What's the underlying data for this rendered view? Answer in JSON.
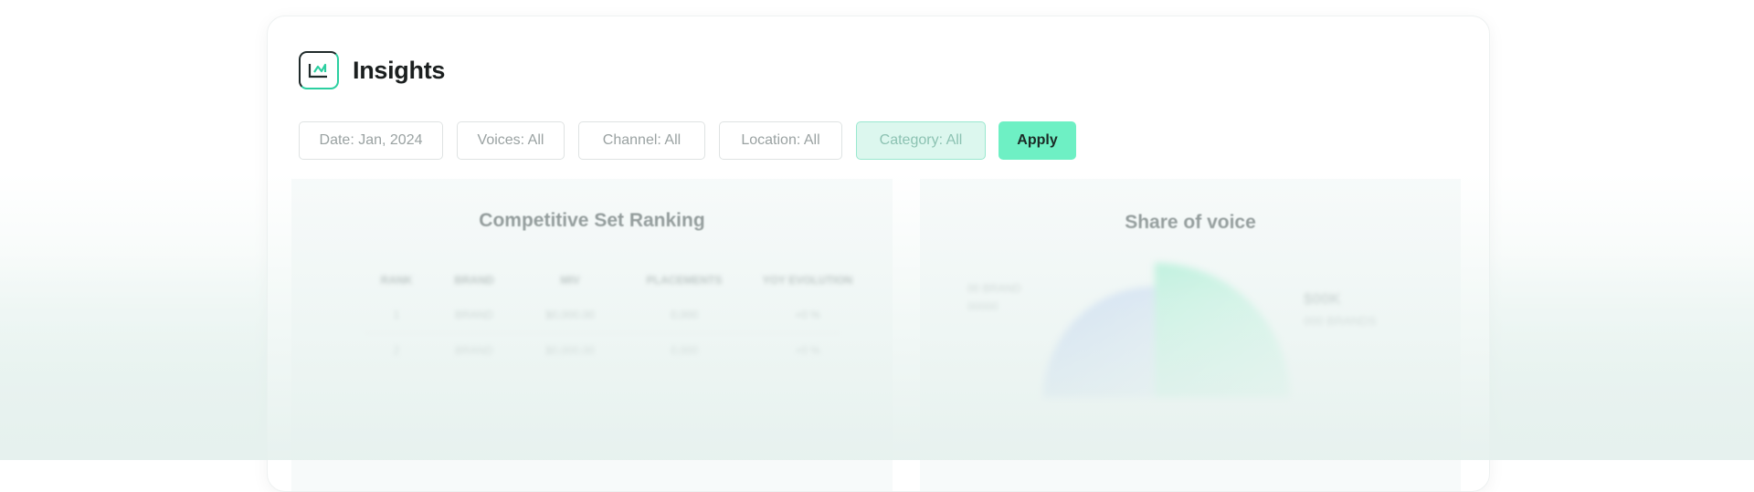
{
  "app": {
    "title": "Insights",
    "logo_icon": "brand-logo-icon",
    "accent_color": "#6ef0c4"
  },
  "filters": {
    "date": "Date: Jan, 2024",
    "voices": "Voices: All",
    "channel": "Channel: All",
    "location": "Location: All",
    "category": "Category: All",
    "apply_label": "Apply"
  },
  "panels": {
    "ranking": {
      "title": "Competitive Set Ranking",
      "columns": [
        "RANK",
        "BRAND",
        "MIV",
        "PLACEMENTS",
        "YOY EVOLUTION"
      ],
      "rows": [
        [
          "1",
          "BRAND",
          "$0,000.00",
          "0,000",
          "+0 %"
        ],
        [
          "2",
          "BRAND",
          "$0,000.00",
          "0,000",
          "+0 %"
        ]
      ]
    },
    "share_of_voice": {
      "title": "Share of voice",
      "legend_value": "$00K",
      "legend_label": "000 BRANDS",
      "side_lines": [
        "00 BRAND",
        "00000"
      ]
    }
  }
}
